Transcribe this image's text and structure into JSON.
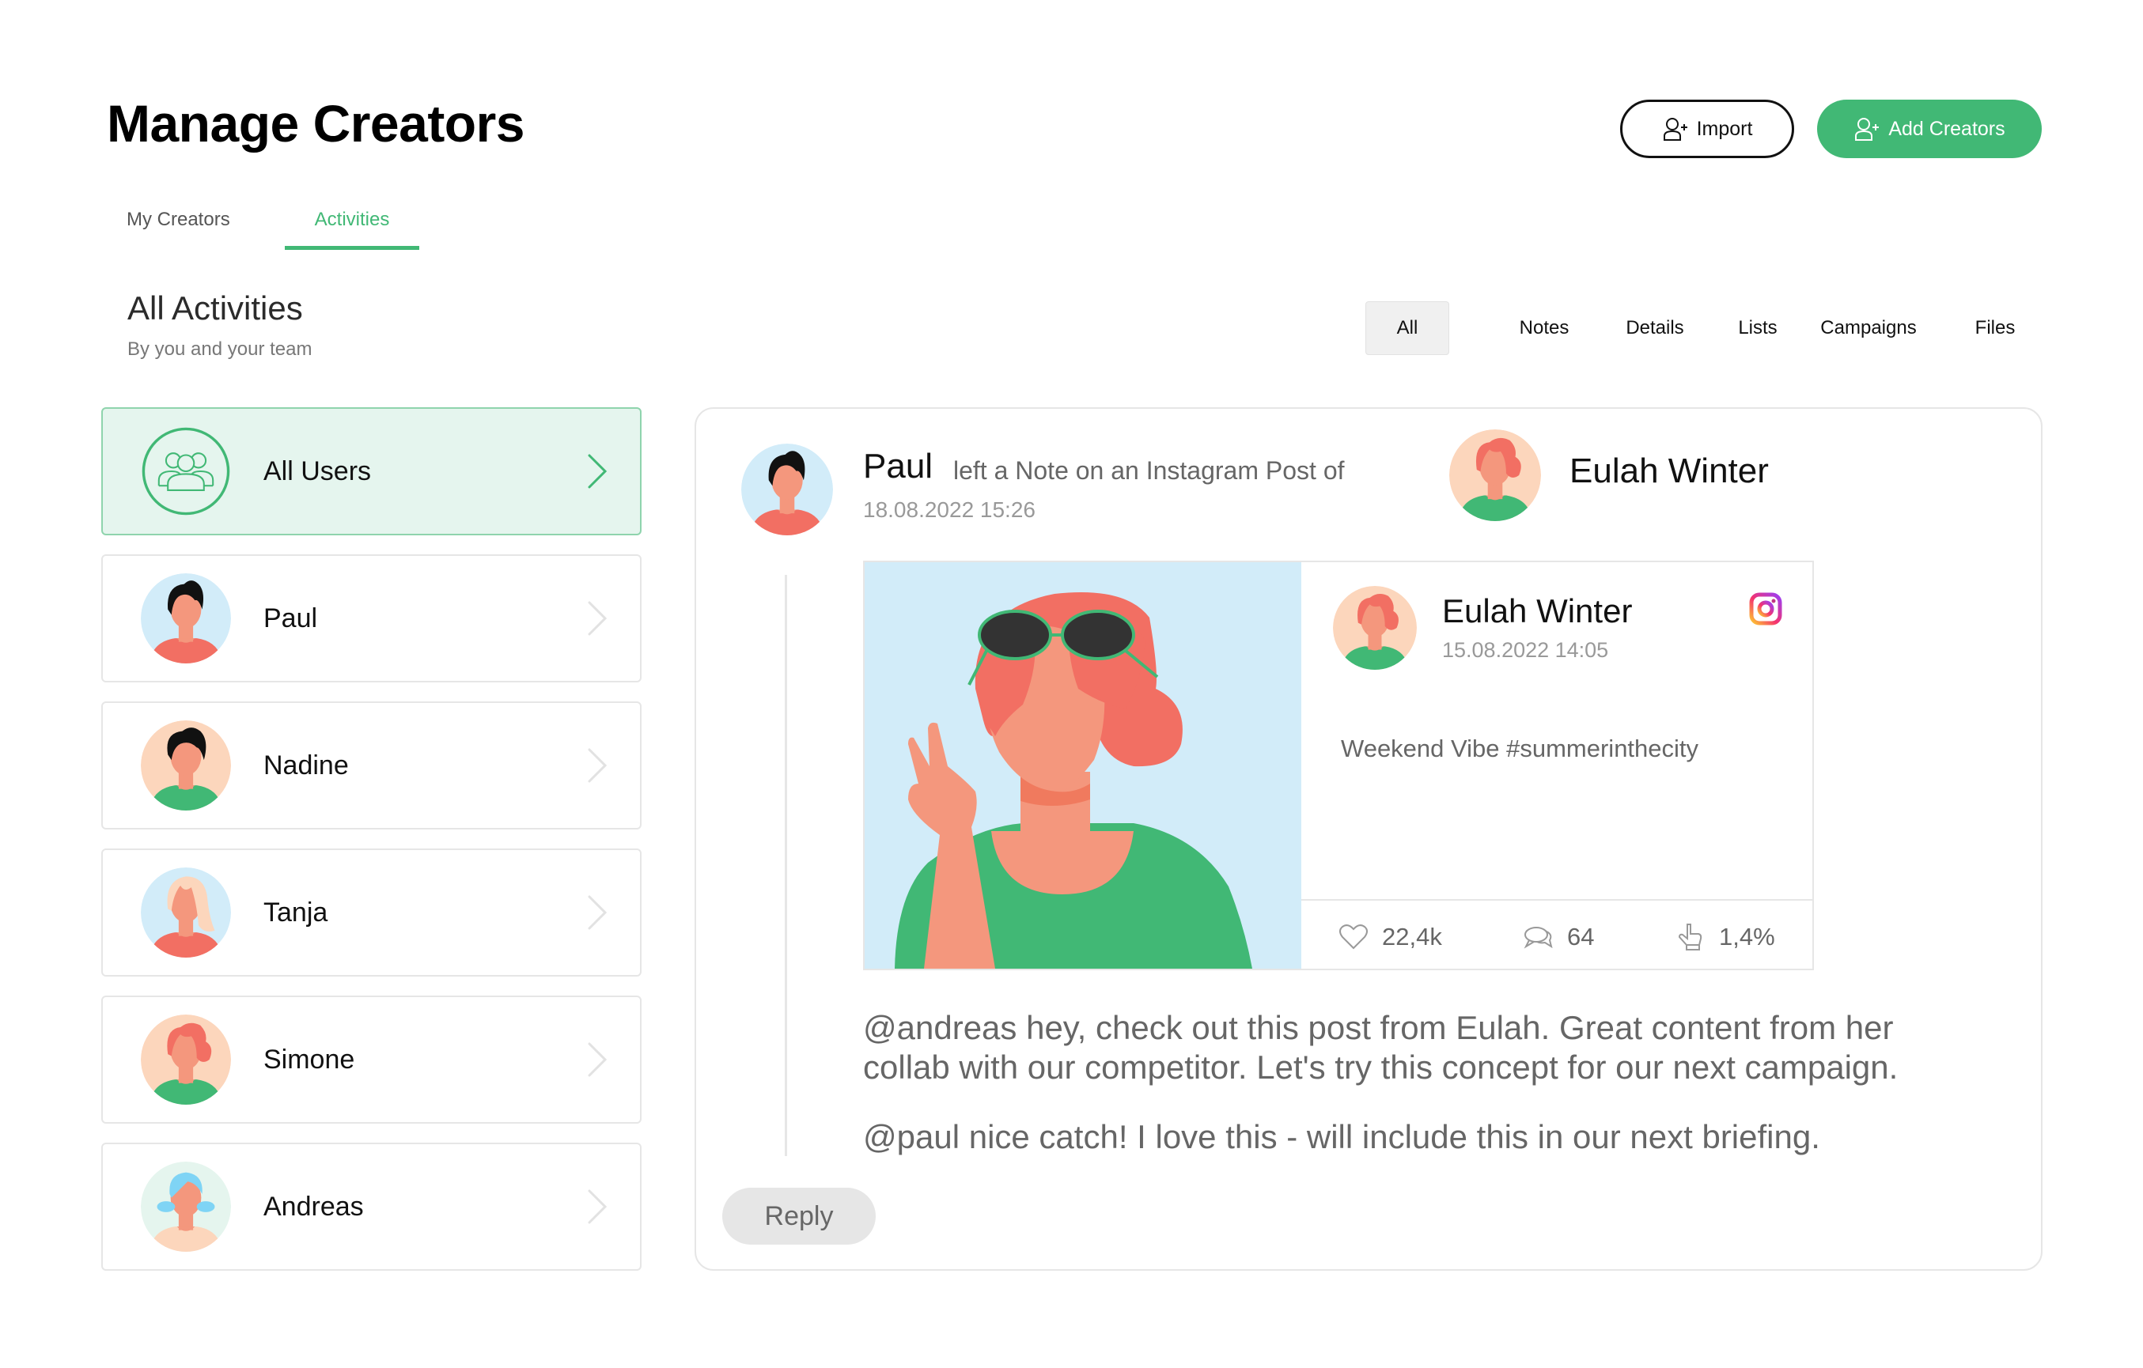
{
  "page": {
    "title": "Manage Creators"
  },
  "header_actions": {
    "import_label": "Import",
    "import_icon": "user-plus-icon",
    "add_label": "Add Creators",
    "add_icon": "user-plus-icon"
  },
  "tabs": [
    {
      "label": "My Creators",
      "active": false
    },
    {
      "label": "Activities",
      "active": true
    }
  ],
  "section": {
    "title": "All Activities",
    "subtitle": "By you and your team"
  },
  "filters": [
    {
      "label": "All",
      "active": true
    },
    {
      "label": "Notes",
      "active": false
    },
    {
      "label": "Details",
      "active": false
    },
    {
      "label": "Lists",
      "active": false
    },
    {
      "label": "Campaigns",
      "active": false
    },
    {
      "label": "Files",
      "active": false
    }
  ],
  "users": [
    {
      "name": "All Users",
      "icon": "users-group-icon",
      "active": true
    },
    {
      "name": "Paul",
      "icon": "avatar-paul",
      "active": false
    },
    {
      "name": "Nadine",
      "icon": "avatar-nadine",
      "active": false
    },
    {
      "name": "Tanja",
      "icon": "avatar-tanja",
      "active": false
    },
    {
      "name": "Simone",
      "icon": "avatar-simone",
      "active": false
    },
    {
      "name": "Andreas",
      "icon": "avatar-andreas",
      "active": false
    }
  ],
  "activity": {
    "user": "Paul",
    "verb": "left a Note on an Instagram Post of",
    "timestamp": "18.08.2022 15:26",
    "target": "Eulah Winter",
    "post": {
      "author": "Eulah Winter",
      "timestamp": "15.08.2022 14:05",
      "platform_icon": "instagram-icon",
      "caption": "Weekend Vibe #summerinthecity",
      "likes": "22,4k",
      "comments": "64",
      "engagement": "1,4%"
    },
    "comments": [
      "@andreas hey, check out this post from Eulah. Great content from her collab with our competitor. Let's try this concept for our next campaign.",
      "@paul nice catch! I love this - will include this in our next briefing."
    ],
    "reply_label": "Reply"
  },
  "colors": {
    "accent": "#41b875",
    "active_card_bg": "#e5f5ee",
    "border": "#e6e6e6",
    "muted_text": "#666666"
  }
}
